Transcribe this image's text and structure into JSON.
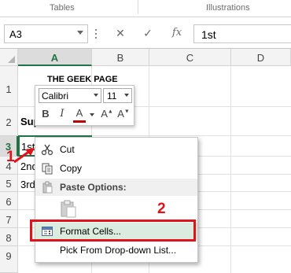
{
  "ribbon": {
    "groups": [
      "Tables",
      "Illustrations"
    ]
  },
  "formula_bar": {
    "name_box": "A3",
    "cancel_icon": "✕",
    "enter_icon": "✓",
    "function_icon": "fx",
    "value": "1st"
  },
  "columns": [
    "A",
    "B",
    "C",
    "D"
  ],
  "rows": [
    "1",
    "2",
    "3",
    "4",
    "5",
    "6",
    "7",
    "8",
    "9"
  ],
  "cells": {
    "A1": "THE GEEK PAGE",
    "A2": "Sup",
    "A3": "1st",
    "A4": "2nd",
    "A5": "3rd"
  },
  "mini_toolbar": {
    "font": "Calibri",
    "size": "11",
    "bold": "B",
    "italic": "I",
    "font_color": "A",
    "grow": "A",
    "shrink": "A"
  },
  "context_menu": {
    "cut": "Cut",
    "copy": "Copy",
    "paste_options": "Paste Options:",
    "format_cells": "Format Cells...",
    "pick_from_list": "Pick From Drop-down List..."
  },
  "annotations": {
    "step1": "1",
    "step2": "2"
  },
  "colors": {
    "annotation_red": "#e1121a",
    "excel_green": "#217346",
    "menu_highlight": "#dbecdf"
  }
}
